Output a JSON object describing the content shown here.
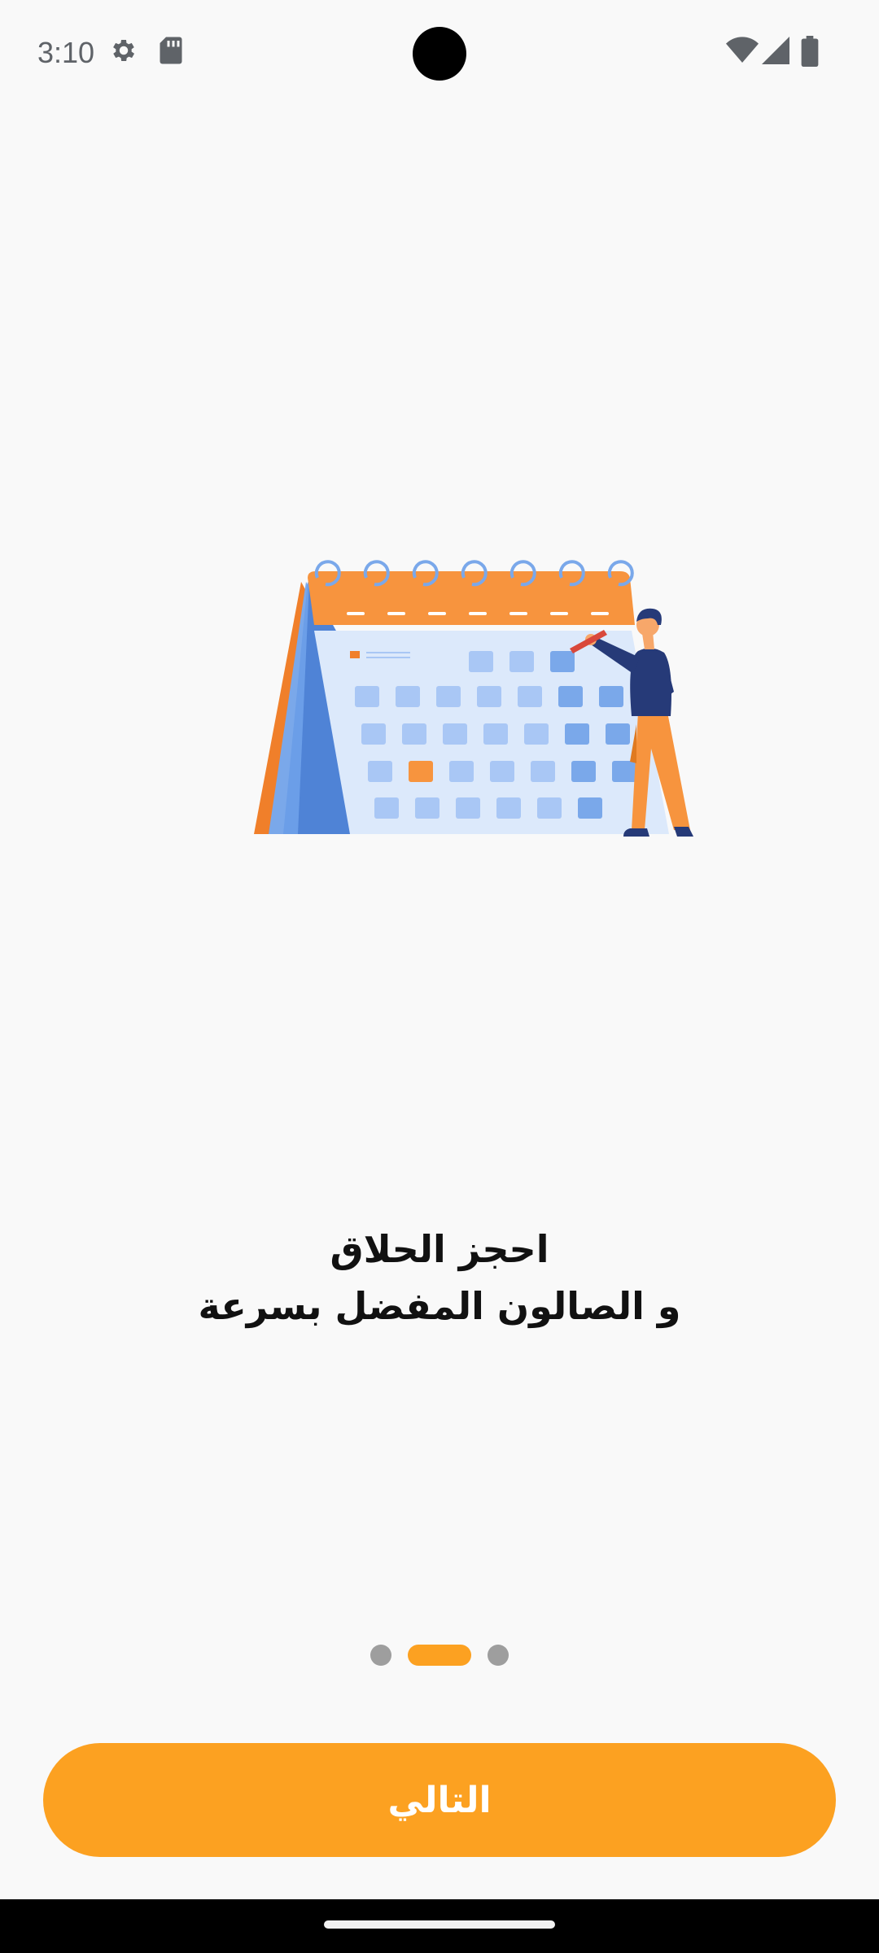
{
  "status_bar": {
    "time": "3:10",
    "left_icons": [
      "settings-icon",
      "sd-card-icon"
    ],
    "right_icons": [
      "wifi-icon",
      "cellular-signal-icon",
      "battery-icon"
    ]
  },
  "illustration": {
    "subject": "calendar-with-person-icon",
    "colors": {
      "orange": "#f7943e",
      "calendar_page": "#dce9fb",
      "blue_light": "#a9c7f5",
      "blue_mid": "#7aa8ea",
      "blue_dark": "#4f83d6",
      "navy": "#263a78"
    }
  },
  "headline": {
    "line1": "احجز الحلاق",
    "line2": "و الصالون  المفضل بسرعة"
  },
  "pager": {
    "total": 3,
    "active_index": 1,
    "active_color": "#fca121",
    "inactive_color": "#9e9e9e"
  },
  "next_button": {
    "label": "التالي",
    "color": "#fca121"
  }
}
